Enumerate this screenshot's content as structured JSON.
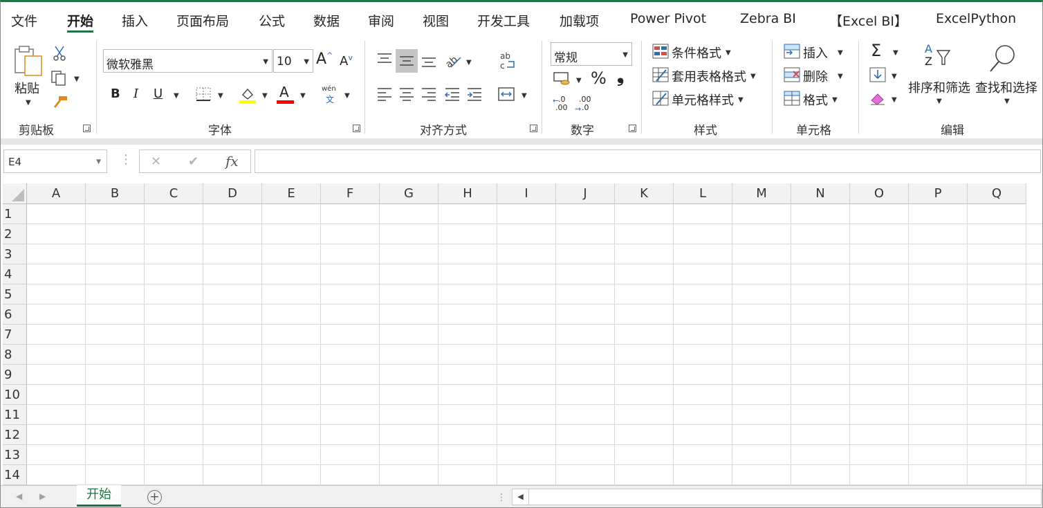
{
  "tabs": [
    "文件",
    "开始",
    "插入",
    "页面布局",
    "公式",
    "数据",
    "审阅",
    "视图",
    "开发工具",
    "加载项",
    "Power Pivot",
    "Zebra BI",
    "【Excel BI】",
    "ExcelPython"
  ],
  "active_tab": "开始",
  "clipboard": {
    "paste_label": "粘贴",
    "group_label": "剪贴板"
  },
  "font": {
    "name": "微软雅黑",
    "size": "10",
    "bold": "B",
    "italic": "I",
    "underline": "U",
    "phonetic_top": "wén",
    "phonetic_bottom": "文",
    "group_label": "字体",
    "fill_color": "#ffff00",
    "font_color": "#ff0000"
  },
  "alignment": {
    "group_label": "对齐方式"
  },
  "number": {
    "format": "常规",
    "percent": "%",
    "comma": "❟",
    "inc_dec_top": ".0",
    "inc_dec_bottom": ".00",
    "dec_dec_top": ".00",
    "dec_dec_bottom": ".0",
    "group_label": "数字"
  },
  "styles": {
    "conditional": "条件格式",
    "table": "套用表格格式",
    "cell_styles": "单元格样式",
    "group_label": "样式"
  },
  "cells": {
    "insert": "插入",
    "delete": "删除",
    "format": "格式",
    "group_label": "单元格"
  },
  "editing": {
    "sort_filter": "排序和筛选",
    "find_select": "查找和选择",
    "group_label": "编辑",
    "sort_top": "A",
    "sort_bottom": "Z",
    "sigma": "Σ"
  },
  "formula_bar": {
    "name_box": "E4",
    "cancel": "✕",
    "enter": "✔",
    "fx": "fx",
    "value": ""
  },
  "columns": [
    "A",
    "B",
    "C",
    "D",
    "E",
    "F",
    "G",
    "H",
    "I",
    "J",
    "K",
    "L",
    "M",
    "N",
    "O",
    "P",
    "Q"
  ],
  "rows": [
    "1",
    "2",
    "3",
    "4",
    "5",
    "6",
    "7",
    "8",
    "9",
    "10",
    "11",
    "12",
    "13",
    "14"
  ],
  "sheets": [
    "开始"
  ],
  "accent_color": "#217346"
}
